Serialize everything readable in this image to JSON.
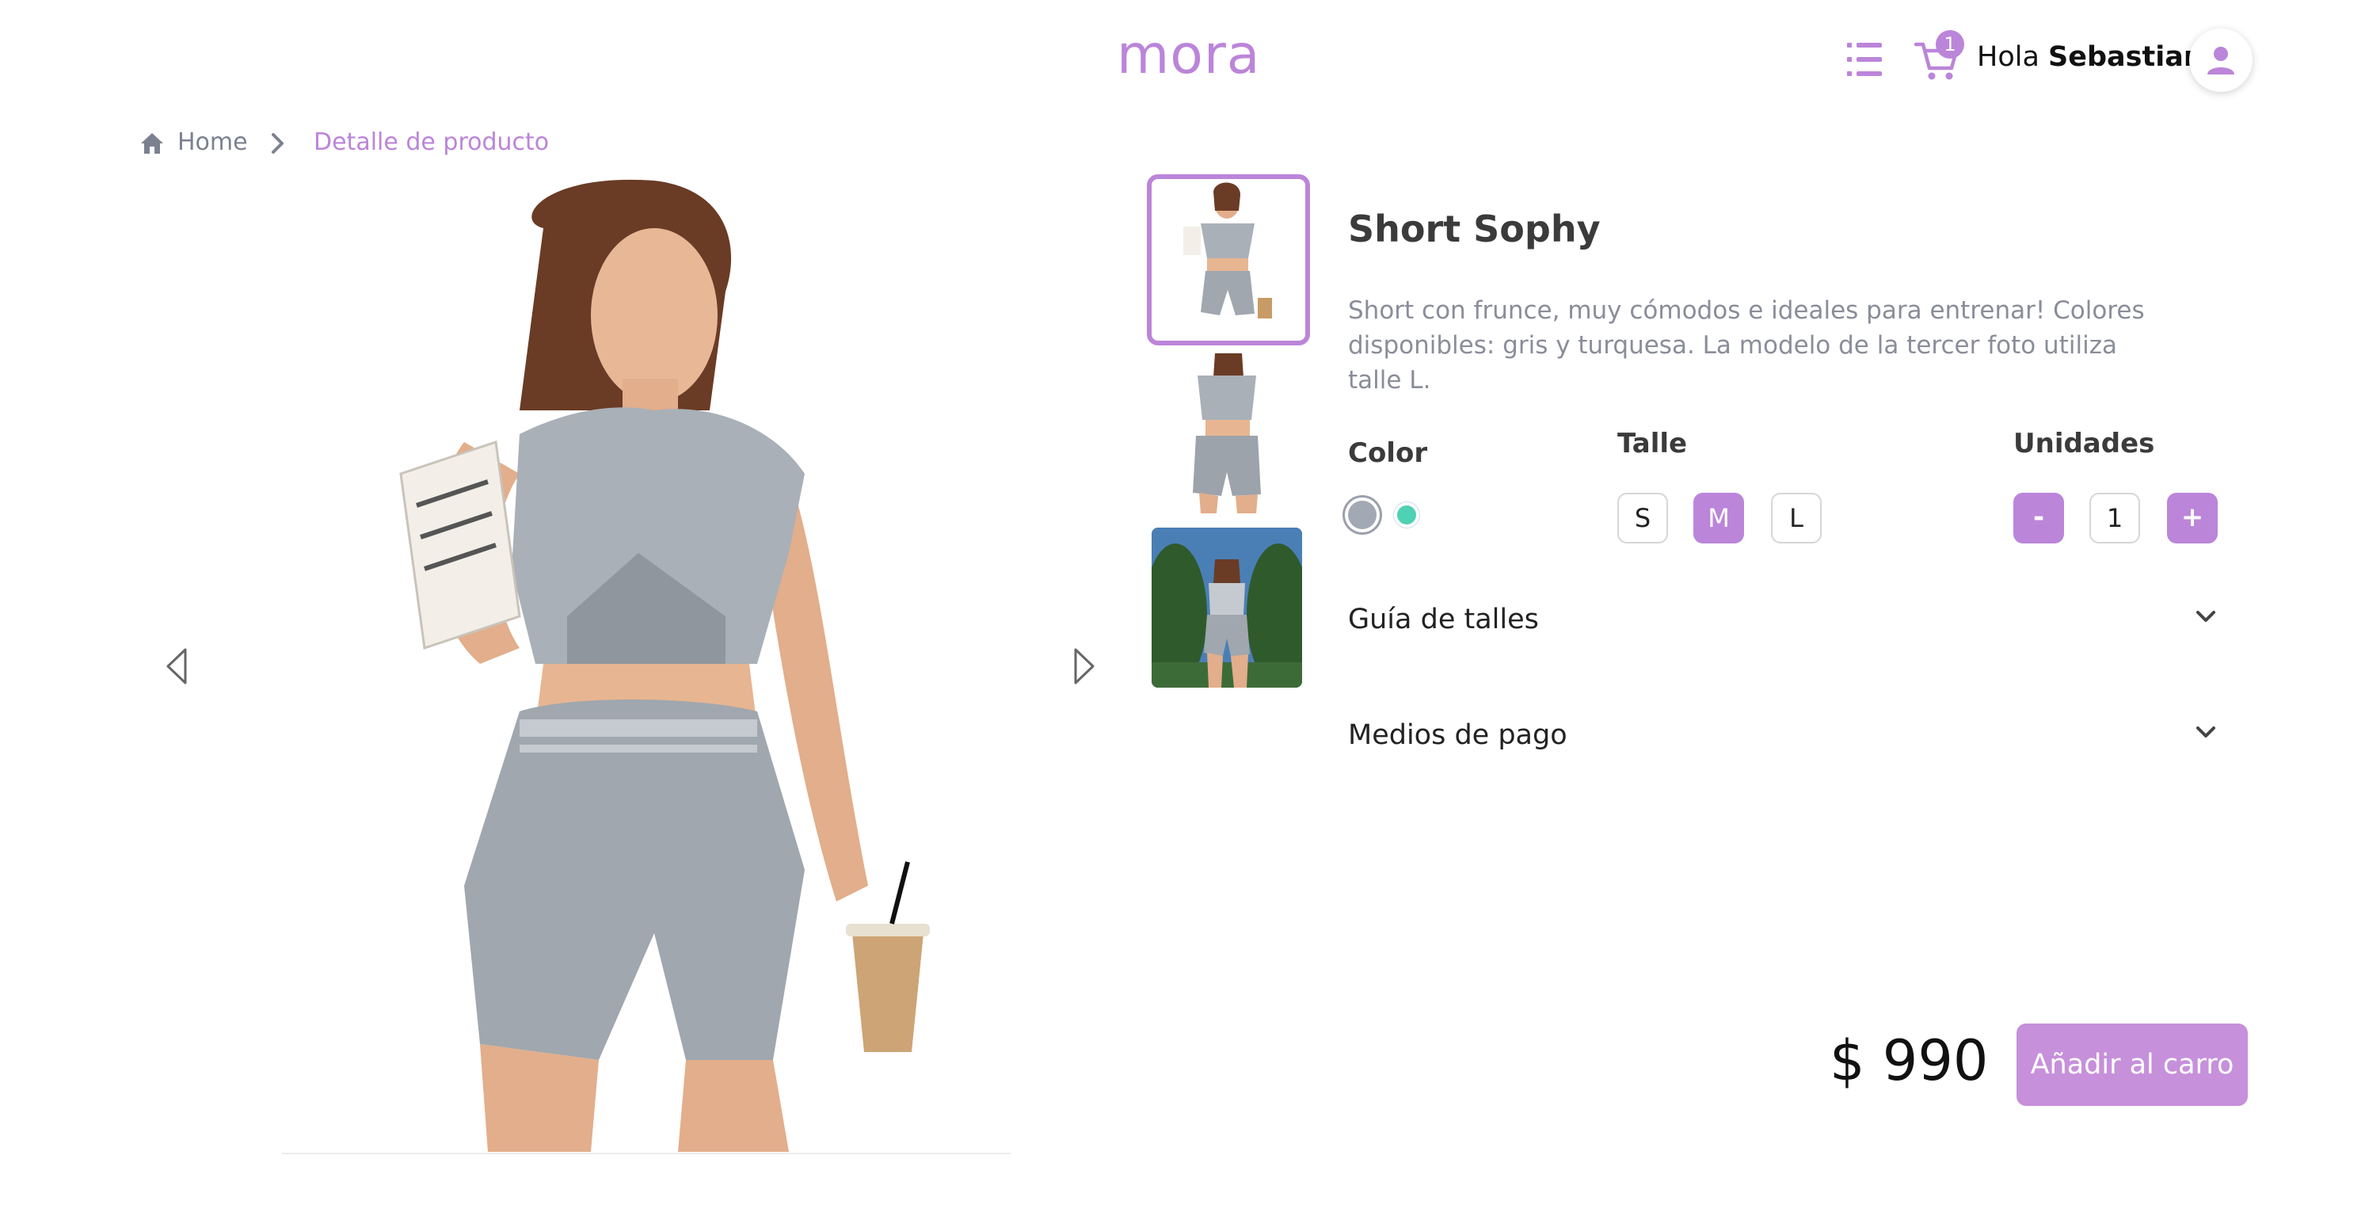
{
  "header": {
    "logo": "mora",
    "cart_count": "1",
    "greeting_prefix": "Hola ",
    "user_name": "Sebastian",
    "greeting_suffix": "!",
    "icons": [
      "menu-list-icon",
      "cart-icon",
      "user-icon"
    ]
  },
  "breadcrumb": {
    "home": "Home",
    "current": "Detalle de producto"
  },
  "product": {
    "title": "Short Sophy",
    "description": "Short con frunce, muy cómodos e ideales para entrenar! Colores disponibles: gris y turquesa. La modelo de la tercer foto utiliza talle L.",
    "color_label": "Color",
    "colors": [
      "#a3a8b5",
      "#4fd1b3"
    ],
    "selected_color": "gris",
    "size_label": "Talle",
    "sizes": [
      "S",
      "M",
      "L"
    ],
    "selected_size": "M",
    "units_label": "Unidades",
    "minus": "-",
    "plus": "+",
    "quantity": "1",
    "accordions": [
      "Guía de talles",
      "Medios de pago"
    ],
    "price": "$ 990",
    "add_to_cart": "Añadir al carro"
  },
  "gallery": {
    "thumbnails": 3,
    "selected_index": 0
  },
  "colors": {
    "accent": "#bb85d9",
    "teal": "#4fd1b3",
    "gray_text": "#8a8d99"
  }
}
